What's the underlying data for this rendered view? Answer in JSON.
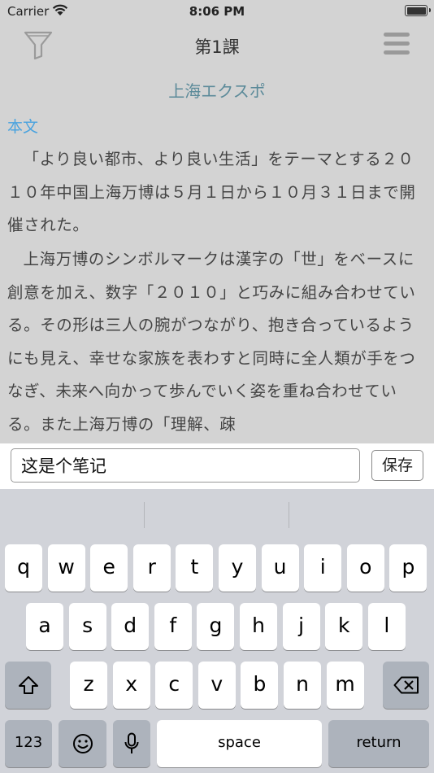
{
  "status_bar": {
    "carrier": "Carrier",
    "time": "8:06 PM"
  },
  "nav": {
    "title": "第1課"
  },
  "lesson": {
    "title": "上海エクスポ",
    "section_label": "本文",
    "paragraphs": [
      "「より良い都市、より良い生活」をテーマとする２０１０年中国上海万博は５月１日から１０月３１日まで開催された。",
      "上海万博のシンボルマークは漢字の「世」をベースに創意を加え、数字「２０１０」と巧みに組み合わせている。その形は三人の腕がつながり、抱き合っているようにも見え、幸せな家族を表わすと同時に全人類が手をつなぎ、未来へ向かって歩んでいく姿を重ね合わせている。また上海万博の「理解、疎"
    ]
  },
  "note": {
    "value": "这是个笔记",
    "save_label": "保存"
  },
  "keyboard": {
    "row1": [
      "q",
      "w",
      "e",
      "r",
      "t",
      "y",
      "u",
      "i",
      "o",
      "p"
    ],
    "row2": [
      "a",
      "s",
      "d",
      "f",
      "g",
      "h",
      "j",
      "k",
      "l"
    ],
    "row3": [
      "z",
      "x",
      "c",
      "v",
      "b",
      "n",
      "m"
    ],
    "numbers_label": "123",
    "space_label": "space",
    "return_label": "return"
  }
}
